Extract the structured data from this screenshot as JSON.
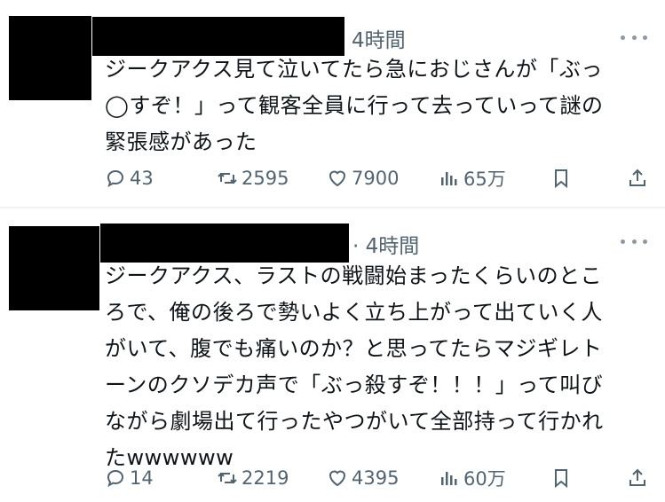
{
  "tweets": [
    {
      "time": "4時間",
      "lines": [
        "ジークアクス見て泣いてたら急におじさんが「ぶっ",
        "◯すぞ！」って観客全員に行って去っていって謎の",
        "緊張感があった"
      ],
      "replies": "43",
      "retweets": "2595",
      "likes": "7900",
      "views": "65万"
    },
    {
      "time": "· 4時間",
      "lines": [
        "ジークアクス、ラストの戦闘始まったくらいのとこ",
        "ろで、俺の後ろで勢いよく立ち上がって出ていく人",
        "がいて、腹でも痛いのか？と思ってたらマジギレト",
        "ーンのクソデカ声で「ぶっ殺すぞ！！！」って叫び",
        "ながら劇場出て行ったやつがいて全部持って行かれ",
        "たwwwwww"
      ],
      "replies": "14",
      "retweets": "2219",
      "likes": "4395",
      "views": "60万"
    }
  ],
  "icons": {
    "reply": "reply-icon",
    "retweet": "retweet-icon",
    "like": "heart-icon",
    "views": "views-icon",
    "bookmark": "bookmark-icon",
    "share": "share-icon",
    "more": "more-icon"
  },
  "colors": {
    "muted": "#536471",
    "divider": "#eff3f4"
  }
}
